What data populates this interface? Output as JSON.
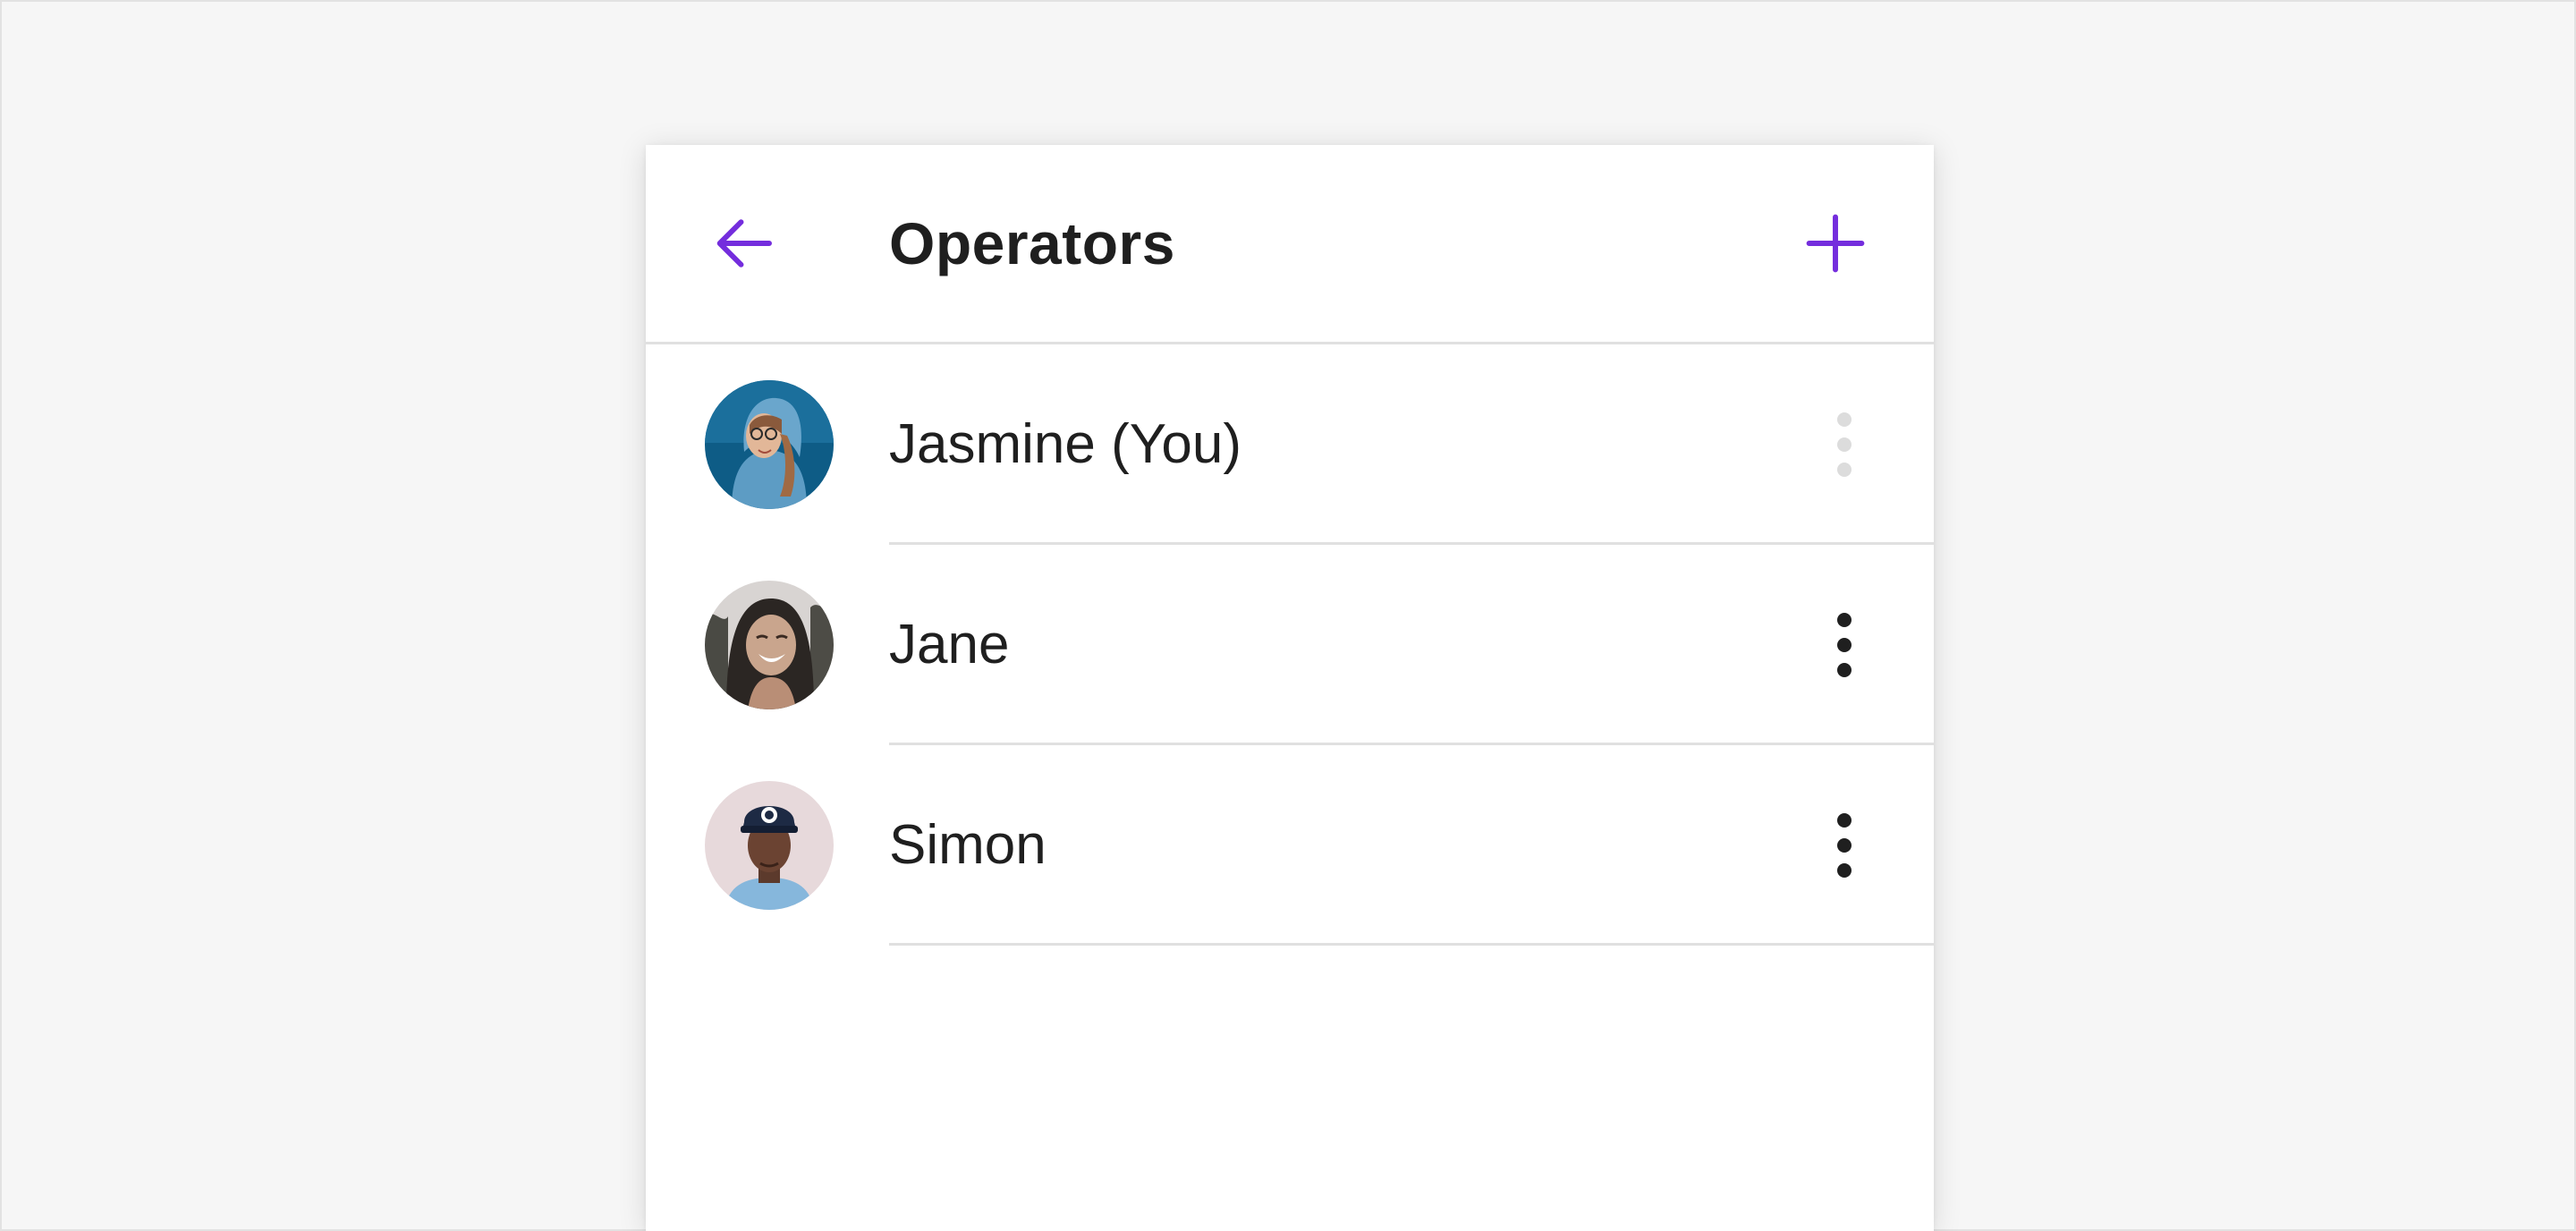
{
  "header": {
    "title": "Operators",
    "back_icon": "arrow-left-icon",
    "add_icon": "plus-icon",
    "accent_color": "#742ddd"
  },
  "operators": [
    {
      "name": "Jasmine (You)",
      "menu_enabled": false,
      "avatar_colors": [
        "#0e5c86",
        "#5d9cc4"
      ]
    },
    {
      "name": "Jane",
      "menu_enabled": true,
      "avatar_colors": [
        "#3d3a38",
        "#c9a58d"
      ]
    },
    {
      "name": "Simon",
      "menu_enabled": true,
      "avatar_colors": [
        "#e7d9db",
        "#6b4332"
      ]
    }
  ],
  "menu_icon": "more-vertical-icon",
  "colors": {
    "background": "#f6f6f6",
    "text": "#1f1f1f",
    "divider": "#e0e0e0",
    "menu_active": "#1f1f1f",
    "menu_disabled": "#dcdcdc"
  }
}
